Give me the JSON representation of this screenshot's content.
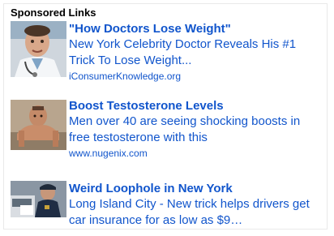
{
  "header": {
    "label": "Sponsored Links"
  },
  "ads": [
    {
      "title": "\"How Doctors Lose Weight\"",
      "desc_line1": "New York Celebrity Doctor Reveals His #1",
      "desc_line2": "Trick To Lose Weight...",
      "url": "iConsumerKnowledge.org",
      "thumb_icon": "doctor-photo"
    },
    {
      "title": "Boost Testosterone Levels",
      "desc_line1": "Men over 40 are seeing shocking boosts in",
      "desc_line2": "free testosterone with this",
      "url": "www.nugenix.com",
      "thumb_icon": "pushup-man-photo"
    },
    {
      "title": "Weird Loophole in New York",
      "desc_line1": "Long Island City - New trick helps drivers get",
      "desc_line2": "car insurance for as low as $9…",
      "url": "",
      "thumb_icon": "police-officer-photo"
    }
  ],
  "colors": {
    "link": "#1155cc",
    "header": "#000000",
    "border": "#e9e9e9"
  }
}
